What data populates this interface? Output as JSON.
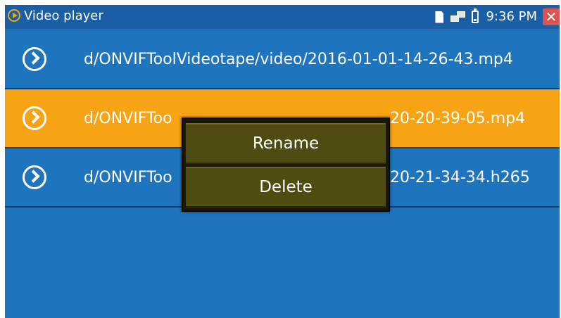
{
  "titlebar": {
    "app_title": "Video player",
    "clock": "9:36 PM",
    "close_glyph": "✕"
  },
  "files": [
    {
      "name": "d/ONVIFToolVideotape/video/2016-01-01-14-26-43.mp4",
      "selected": false
    },
    {
      "name_left": "d/ONVIFToo",
      "name_right": "20-20-39-05.mp4",
      "selected": true
    },
    {
      "name_left": "d/ONVIFToo",
      "name_right": "20-21-34-34.h265",
      "selected": false
    }
  ],
  "context_menu": {
    "rename_label": "Rename",
    "delete_label": "Delete"
  },
  "colors": {
    "background": "#1f74be",
    "selected_row": "#f6a314",
    "menu_item": "#4f4c12",
    "close_button": "#d9534f",
    "accent": "#f4a614"
  },
  "icons": {
    "app": "play-circle-icon",
    "row": "chevron-circle-icon",
    "sd": "sd-card-icon",
    "network": "network-icon",
    "battery": "battery-icon",
    "close": "close-icon"
  }
}
